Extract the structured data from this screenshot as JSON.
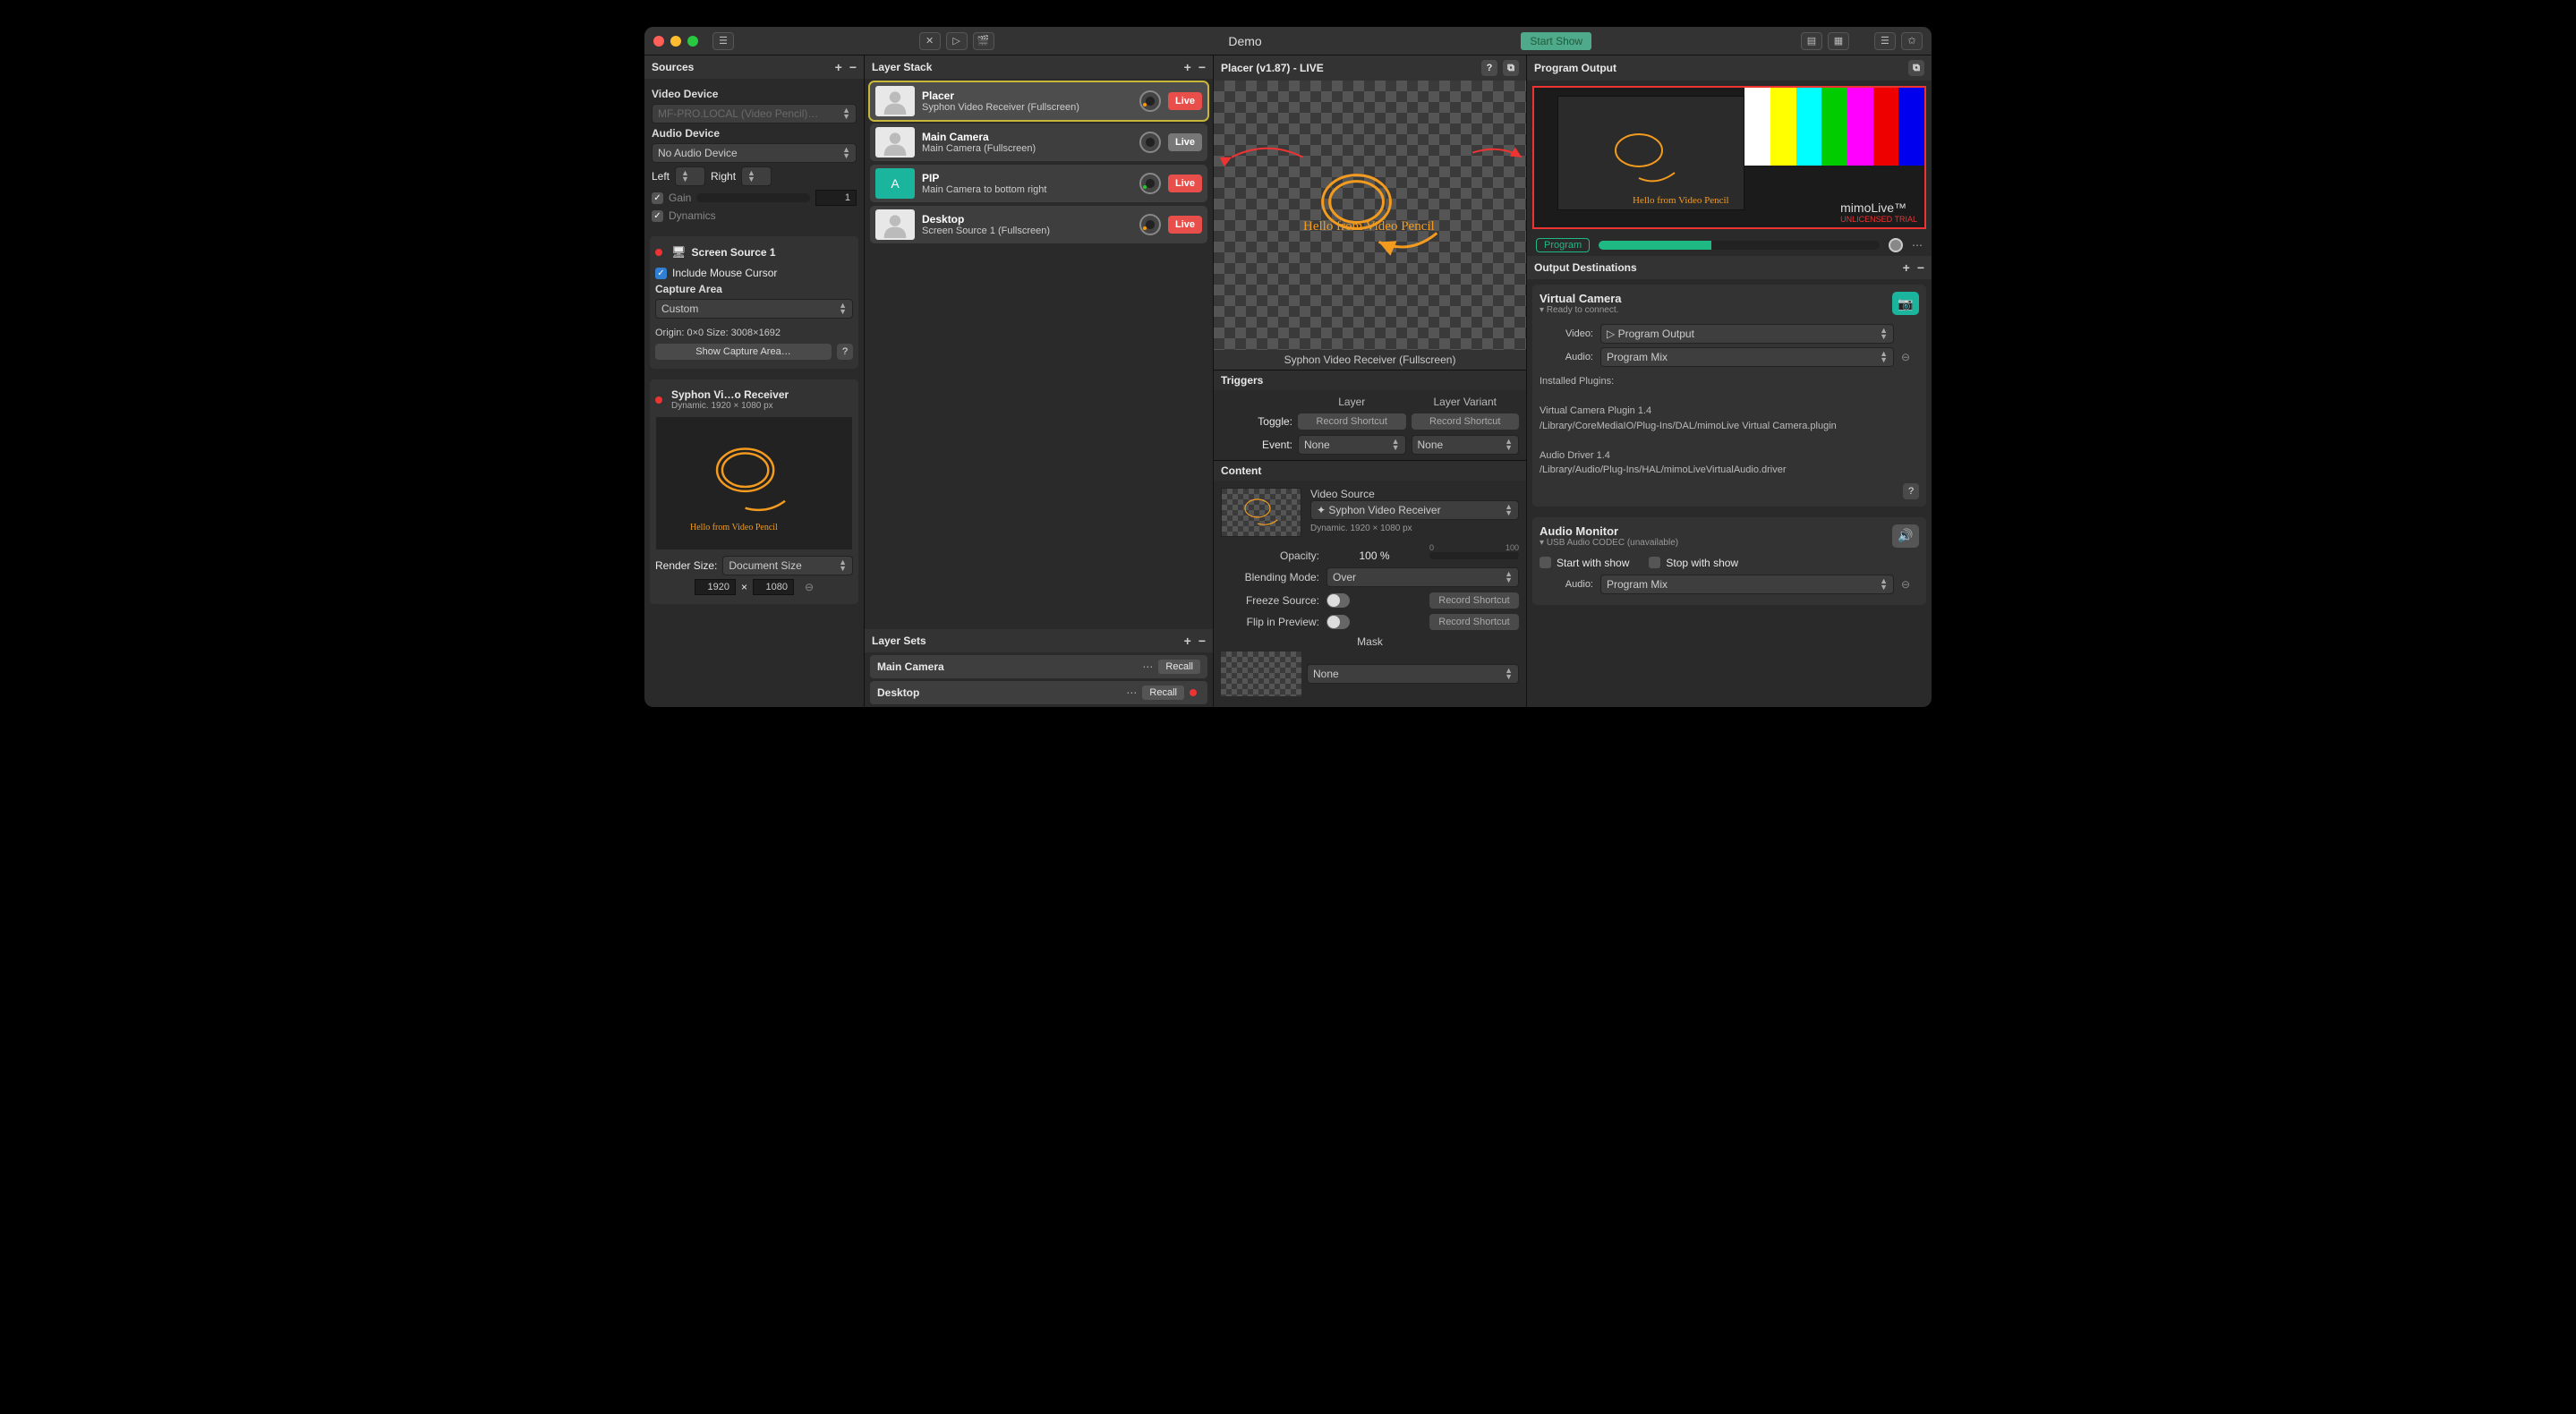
{
  "title": "Demo",
  "start_show": "Start Show",
  "sources": {
    "header": "Sources",
    "video_device": "Video Device",
    "video_sel": "MF-PRO.LOCAL (Video Pencil)…",
    "audio_device": "Audio Device",
    "audio_sel": "No Audio Device",
    "left": "Left",
    "right": "Right",
    "gain": "Gain",
    "gain_val": "1",
    "dynamics": "Dynamics",
    "screen_src": {
      "name": "Screen Source 1",
      "include_cursor": "Include Mouse Cursor",
      "capture_area": "Capture Area",
      "capture_sel": "Custom",
      "origin": "Origin: 0×0 Size: 3008×1692",
      "show_btn": "Show Capture Area…"
    },
    "syphon": {
      "name": "Syphon Vi…o Receiver",
      "sub": "Dynamic. 1920 × 1080 px",
      "anno": "Hello from Video Pencil",
      "render": "Render Size:",
      "render_sel": "Document Size",
      "w": "1920",
      "h": "1080"
    }
  },
  "layer_stack": {
    "header": "Layer Stack",
    "layers": [
      {
        "title": "Placer",
        "sub": "Syphon Video Receiver (Fullscreen)",
        "live": "Live",
        "live_on": true,
        "sel": true,
        "knob": "o",
        "thumb": "person"
      },
      {
        "title": "Main Camera",
        "sub": "Main Camera (Fullscreen)",
        "live": "Live",
        "live_on": false,
        "knob": "",
        "thumb": "person"
      },
      {
        "title": "PIP",
        "sub": "Main Camera to bottom right",
        "live": "Live",
        "live_on": true,
        "knob": "g",
        "thumb": "teal"
      },
      {
        "title": "Desktop",
        "sub": "Screen Source 1 (Fullscreen)",
        "live": "Live",
        "live_on": true,
        "knob": "o",
        "thumb": "person"
      }
    ]
  },
  "layer_sets": {
    "header": "Layer Sets",
    "items": [
      {
        "name": "Main Camera",
        "recall": "Recall",
        "dot": false
      },
      {
        "name": "Desktop",
        "recall": "Recall",
        "dot": true
      }
    ]
  },
  "inspector": {
    "header": "Placer (v1.87) - LIVE",
    "preview_caption": "Syphon Video Receiver (Fullscreen)",
    "anno": "Hello from Video Pencil",
    "triggers": "Triggers",
    "layer_hd": "Layer",
    "variant_hd": "Layer Variant",
    "toggle_lab": "Toggle:",
    "event_lab": "Event:",
    "rec": "Record Shortcut",
    "none": "None",
    "content": "Content",
    "video_source": "Video Source",
    "vs_sel": "Syphon Video Receiver",
    "vs_sub": "Dynamic. 1920 × 1080 px",
    "opacity_lab": "Opacity:",
    "opacity": "100 %",
    "op_min": "0",
    "op_max": "100",
    "blend_lab": "Blending Mode:",
    "blend": "Over",
    "freeze": "Freeze Source:",
    "flip": "Flip in Preview:",
    "mask": "Mask",
    "mask_sel": "None"
  },
  "program": {
    "header": "Program Output",
    "brand": "mimoLive",
    "brand_sub": "UNLICENSED TRIAL",
    "anno": "Hello from Video Pencil",
    "program": "Program"
  },
  "out_dest": {
    "header": "Output Destinations",
    "vc": {
      "title": "Virtual Camera",
      "status": "Ready to connect.",
      "video_lab": "Video:",
      "video_sel": "Program Output",
      "audio_lab": "Audio:",
      "audio_sel": "Program Mix",
      "installed": "Installed Plugins:",
      "p1": "Virtual Camera Plugin 1.4",
      "p1_path": "/Library/CoreMediaIO/Plug-Ins/DAL/mimoLive Virtual Camera.plugin",
      "p2": "Audio Driver 1.4",
      "p2_path": "/Library/Audio/Plug-Ins/HAL/mimoLiveVirtualAudio.driver"
    }
  },
  "audio_mon": {
    "header": "Audio Monitor",
    "codec": "USB Audio CODEC  (unavailable)",
    "start": "Start with show",
    "stop": "Stop with show",
    "audio_lab": "Audio:",
    "audio_sel": "Program Mix"
  }
}
